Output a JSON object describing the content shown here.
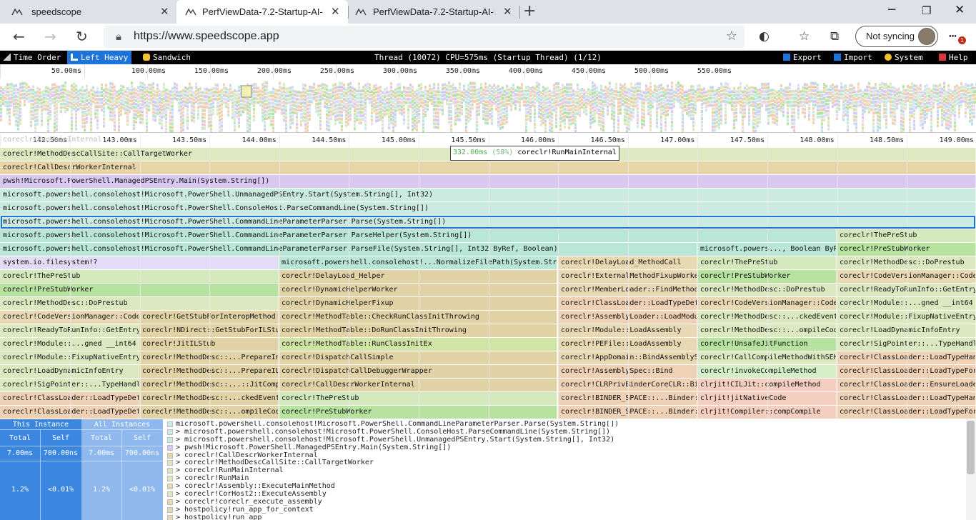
{
  "browser": {
    "tabs": [
      {
        "title": "speedscope"
      },
      {
        "title": "PerfViewData-7.2-Startup-AI-DTF..."
      },
      {
        "title": "PerfViewData-7.2-Startup-AI-DTF..."
      }
    ],
    "url": "https://www.speedscope.app",
    "sync_label": "Not syncing",
    "notification_count": "1"
  },
  "toolbar": {
    "view_buttons": [
      {
        "label": "Time Order",
        "icon": "time-order-icon"
      },
      {
        "label": "Left Heavy",
        "icon": "left-heavy-icon"
      },
      {
        "label": "Sandwich",
        "icon": "sandwich-icon"
      }
    ],
    "title": "Thread (10072) CPU=575ms (Startup Thread) (1/12)",
    "right_buttons": [
      {
        "label": "Export",
        "icon": "export-icon"
      },
      {
        "label": "Import",
        "icon": "import-icon"
      },
      {
        "label": "System",
        "icon": "system-icon"
      },
      {
        "label": "Help",
        "icon": "help-icon"
      }
    ]
  },
  "minimap": {
    "ruler": [
      "50.00ms",
      "100.00ms",
      "150.00ms",
      "200.00ms",
      "250.00ms",
      "300.00ms",
      "350.00ms",
      "400.00ms",
      "450.00ms",
      "500.00ms",
      "550.00ms"
    ]
  },
  "flamegraph": {
    "ruler": [
      "142.50ms",
      "143.00ms",
      "143.50ms",
      "144.00ms",
      "144.50ms",
      "145.00ms",
      "145.50ms",
      "146.00ms",
      "146.50ms",
      "147.00ms",
      "147.50ms",
      "148.00ms",
      "148.50ms",
      "149.00ms"
    ],
    "ghost_label": "coreclr!RunMainInternal",
    "hover": {
      "time": "332.00ms",
      "percent": "(58%)",
      "name": "coreclr!RunMainInternal"
    },
    "rows": [
      [
        [
          "coreclr!MethodDescCallSite::CallTargetWorker",
          "#dfe9c1"
        ]
      ],
      [
        [
          "coreclr!CallDescrWorkerInternal",
          "#e8d6a8"
        ]
      ],
      [
        [
          "pwsh!Microsoft.PowerShell.ManagedPSEntry.Main(System.String[])",
          "#d9c8f2"
        ]
      ],
      [
        [
          "microsoft.powershell.consolehost!Microsoft.PowerShell.UnmanagedPSEntry.Start(System.String[], Int32)",
          "#cbeae0"
        ]
      ],
      [
        [
          "microsoft.powershell.consolehost!Microsoft.PowerShell.ConsoleHost.ParseCommandLine(System.String[])",
          "#cbeae0"
        ]
      ],
      [
        [
          "microsoft.powershell.consolehost!Microsoft.PowerShell.CommandLineParameterParser.Parse(System.String[])",
          "#cbeae0"
        ]
      ],
      [
        [
          "microsoft.powershell.consolehost!Microsoft.PowerShell.CommandLineParameterParser.ParseHelper(System.String[])",
          "#b9e6d6"
        ],
        [
          "coreclr!ThePreStub",
          "#d4eabd"
        ]
      ],
      [
        [
          "microsoft.powershell.consolehost!Microsoft.PowerShell.CommandLineParameterParser.ParseFile(System.String[], Int32 ByRef, Boolean)",
          "#b9e6d6"
        ],
        [
          "microsoft.powers..., Boolean ByRef",
          "#b9e6d6"
        ],
        [
          "coreclr!PreStubWorker",
          "#b7e2a0"
        ]
      ],
      [
        [
          "system.io.filesystem!?",
          "#e3dcf7"
        ],
        [
          "microsoft.powershell.consolehost!...NormalizeFilePath(System.String",
          "#b9e6d6"
        ],
        [
          "coreclr!DelayLoad_MethodCall",
          "#e9d9b1"
        ],
        [
          "coreclr!ThePreStub",
          "#d4eabd"
        ],
        [
          "coreclr!MethodDesc::DoPrestub",
          "#dce8bf"
        ]
      ],
      [
        [
          "coreclr!ThePreStub",
          "#d4eabd"
        ],
        [
          "coreclr!DelayLoad_Helper",
          "#e2d3a7"
        ],
        [
          "coreclr!ExternalMethodFixupWorke",
          "#e8d9b4"
        ],
        [
          "coreclr!PreStubWorker",
          "#b7e2a0"
        ],
        [
          "coreclr!CodeVersionManager::CodeIfNecessar",
          "#e8d9b4"
        ]
      ],
      [
        [
          "coreclr!PreStubWorker",
          "#b7e2a0"
        ],
        [
          "coreclr!DynamicHelperWorker",
          "#e2d3a7"
        ],
        [
          "coreclr!MemberLoader::FindMethodFromMemberRe",
          "#e8d9b4"
        ],
        [
          "coreclr!MethodDesc::DoPrestub",
          "#dce8bf"
        ],
        [
          "coreclr!ReadyToRunInfo::GetEntryPoint",
          "#dce8bf"
        ]
      ],
      [
        [
          "coreclr!MethodDesc::DoPrestub",
          "#dce8bf"
        ],
        [
          "coreclr!DynamicHelperFixup",
          "#e2d3a7"
        ],
        [
          "coreclr!ClassLoader::LoadTypeDefOrRefThrowin",
          "#efd2b6"
        ],
        [
          "coreclr!CodeVersionManager::CodeIfNecessar",
          "#e8d9b4"
        ],
        [
          "coreclr!Module::...gned __int64 *)",
          "#dce8bf"
        ]
      ],
      [
        [
          "coreclr!CodeVersionManager::CodeIfNecessar",
          "#e8d9b4"
        ],
        [
          "coreclr!GetStubForInteropMethod",
          "#e2d3a7"
        ],
        [
          "coreclr!MethodTable::CheckRunClassInitThrowing",
          "#e2d3a7"
        ],
        [
          "coreclr!AssemblyLoader::LoadModuleByTypeRe",
          "#efd2b6"
        ],
        [
          "coreclr!MethodDesc::...ckedEventWrappe",
          "#dce8bf"
        ],
        [
          "coreclr!Module::FixupNativeEntry",
          "#dce8bf"
        ]
      ],
      [
        [
          "coreclr!ReadyToRunInfo::GetEntryPoin",
          "#dce8bf"
        ],
        [
          "coreclr!NDirect::GetStubForILStu",
          "#e2d3a7"
        ],
        [
          "coreclr!MethodTable::DoRunClassInitThrowing",
          "#e2d3a7"
        ],
        [
          "coreclr!Module::LoadAssembly",
          "#e8d9b4"
        ],
        [
          "coreclr!MethodDesc::...ompileCodeLocke",
          "#dce8bf"
        ],
        [
          "coreclr!LoadDynamicInfoEntry",
          "#dce8bf"
        ]
      ],
      [
        [
          "coreclr!Module::...gned __int64 *)",
          "#dce8bf"
        ],
        [
          "coreclr!JitILStub",
          "#e2d3a7"
        ],
        [
          "coreclr!MethodTable::RunClassInitEx",
          "#d0e4a5"
        ],
        [
          "coreclr!PEFile::LoadAssembly",
          "#e8d9b4"
        ],
        [
          "coreclr!UnsafeJitFunction",
          "#b7e2a0"
        ],
        [
          "coreclr!SigPointer::...TypeHandleThrowin",
          "#dce8bf"
        ]
      ],
      [
        [
          "coreclr!Module::FixupNativeEntry",
          "#dce8bf"
        ],
        [
          "coreclr!MethodDesc::...PrepareInitialCod",
          "#e2d3a7"
        ],
        [
          "coreclr!DispatchCallSimple",
          "#e2d3a7"
        ],
        [
          "coreclr!AppDomain::BindAssemblySpe",
          "#e8d9b4"
        ],
        [
          "coreclr!CallCompileMethodWithSEHWrappe",
          "#dce8bf"
        ],
        [
          "coreclr!ClassLoader::LoadTypeHandleForTypeKe",
          "#efd2b6"
        ]
      ],
      [
        [
          "coreclr!LoadDynamicInfoEntry",
          "#dce8bf"
        ],
        [
          "coreclr!MethodDesc::...PrepareILBasedCod",
          "#e2d3a7"
        ],
        [
          "coreclr!DispatchCallDebuggerWrapper",
          "#e2d3a7"
        ],
        [
          "coreclr!AssemblySpec::Bind",
          "#efd2b6"
        ],
        [
          "coreclr!invokeCompileMethod",
          "#d6efc8"
        ],
        [
          "coreclr!ClassLoader::LoadTypeForTypeKey_Bod",
          "#efd2b6"
        ]
      ],
      [
        [
          "coreclr!SigPointer::...TypeHandleThrowin",
          "#dce8bf"
        ],
        [
          "coreclr!MethodDesc::...::JitCompileCod",
          "#e2d3a7"
        ],
        [
          "coreclr!CallDescrWorkerInternal",
          "#e2d3a7"
        ],
        [
          "coreclr!CLRPrivBinderCoreCLR::BindAssemblyByNam",
          "#efd2b6"
        ],
        [
          "clrjit!CILJit::compileMethod",
          "#f4cfc0"
        ],
        [
          "coreclr!ClassLoader::EnsureLoade",
          "#efd2b6"
        ]
      ],
      [
        [
          "coreclr!ClassLoader::LoadTypeDefOrRefThrowin",
          "#efd2b6"
        ],
        [
          "coreclr!MethodDesc::...ckedEventWrappe",
          "#e2d3a7"
        ],
        [
          "coreclr!ThePreStub",
          "#d4eabd"
        ],
        [
          "coreclr!BINDER_SPACE::...Binder::BindAssembl",
          "#efd2b6"
        ],
        [
          "clrjit!jitNativeCode",
          "#f4cfc0"
        ],
        [
          "coreclr!ClassLoader::LoadTypeHandleForTypeKe",
          "#efd2b6"
        ]
      ],
      [
        [
          "coreclr!ClassLoader::LoadTypeDefOrRefThrowin",
          "#efd2b6"
        ],
        [
          "coreclr!MethodDesc::...ompileCodeLocke",
          "#e2d3a7"
        ],
        [
          "coreclr!PreStubWorker",
          "#b7e2a0"
        ],
        [
          "coreclr!BINDER_SPACE::...Binder::BindByNam",
          "#efd2b6"
        ],
        [
          "clrjit!Compiler::compCompile",
          "#f4cfc0"
        ],
        [
          "coreclr!ClassLoader::LoadTypeForTypeKey_Bod",
          "#efd2b6"
        ]
      ]
    ]
  },
  "details": {
    "this_instance": {
      "header": "This Instance",
      "total_label": "Total",
      "self_label": "Self",
      "total": "7.00ms",
      "self": "700.00ns",
      "total_pct": "1.2%",
      "self_pct": "<0.01%"
    },
    "all_instances": {
      "header": "All Instances",
      "total_label": "Total",
      "self_label": "Self",
      "total": "7.00ms",
      "self": "700.00ns",
      "total_pct": "1.2%",
      "self_pct": "<0.01%"
    },
    "stack": [
      "microsoft.powershell.consolehost!Microsoft.PowerShell.CommandLineParameterParser.Parse(System.String[])",
      "> microsoft.powershell.consolehost!Microsoft.PowerShell.ConsoleHost.ParseCommandLine(System.String[])",
      "> microsoft.powershell.consolehost!Microsoft.PowerShell.UnmanagedPSEntry.Start(System.String[], Int32)",
      "> pwsh!Microsoft.PowerShell.ManagedPSEntry.Main(System.String[])",
      "> coreclr!CallDescrWorkerInternal",
      "> coreclr!MethodDescCallSite::CallTargetWorker",
      "> coreclr!RunMainInternal",
      "> coreclr!RunMain",
      "> coreclr!Assembly::ExecuteMainMethod",
      "> coreclr!CorHost2::ExecuteAssembly",
      "> coreclr!coreclr_execute_assembly",
      "> hostpolicy!run_app_for_context",
      "> hostpolicy!run_app"
    ]
  },
  "colors": {
    "accent": "#1f73d8",
    "details_dark": "#3b87e0",
    "details_light": "#8fb9ee"
  }
}
